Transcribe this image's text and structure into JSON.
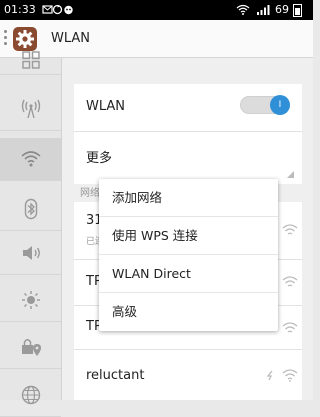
{
  "status_bar": {
    "time": "01:33",
    "battery_percent": "69",
    "icons": [
      "message-icon",
      "sync-icon",
      "cat-icon",
      "wifi-icon",
      "signal-icon",
      "battery-icon"
    ]
  },
  "action_bar": {
    "app_icon": "settings-gear-icon",
    "title": "WLAN"
  },
  "rail": {
    "items": [
      {
        "icon": "grid-icon"
      },
      {
        "icon": "antenna-icon"
      },
      {
        "icon": "wifi-icon",
        "active": true
      },
      {
        "icon": "bluetooth-icon"
      },
      {
        "icon": "volume-icon"
      },
      {
        "icon": "brightness-icon"
      },
      {
        "icon": "lock-location-icon"
      },
      {
        "icon": "globe-icon"
      }
    ]
  },
  "settings": {
    "wlan_label": "WLAN",
    "wlan_toggle_state": "I",
    "more_label": "更多",
    "section_label": "网络"
  },
  "networks": [
    {
      "name": "31",
      "status": "已连"
    },
    {
      "name": "TP"
    },
    {
      "name": "TP"
    },
    {
      "name": "reluctant"
    }
  ],
  "popup_menu": {
    "items": [
      "添加网络",
      "使用 WPS 连接",
      "WLAN Direct",
      "高级"
    ]
  },
  "colors": {
    "accent": "#2f8fd7",
    "app_icon_bg": "#8a4a2f"
  }
}
